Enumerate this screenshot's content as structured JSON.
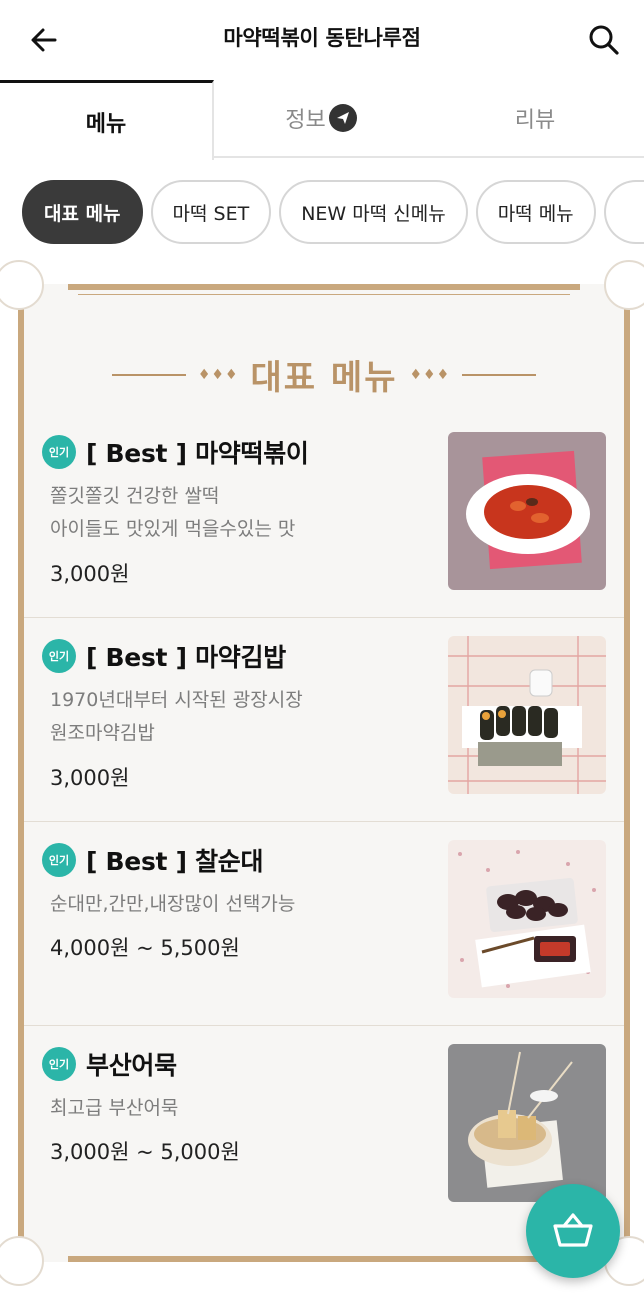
{
  "header": {
    "title": "마약떡볶이 동탄나루점",
    "back_icon": "arrow-left-icon",
    "search_icon": "search-icon"
  },
  "tabs": [
    {
      "label": "메뉴",
      "active": true
    },
    {
      "label": "정보",
      "active": false,
      "icon": "send-badge-icon"
    },
    {
      "label": "리뷰",
      "active": false
    }
  ],
  "chips": [
    {
      "label": "대표 메뉴",
      "active": true
    },
    {
      "label": "마떡 SET",
      "active": false
    },
    {
      "label": "NEW 마떡 신메뉴",
      "active": false
    },
    {
      "label": "마떡 메뉴",
      "active": false
    }
  ],
  "board": {
    "title": "대표 메뉴",
    "ornament": "♦♦♦"
  },
  "items": [
    {
      "badge": "인기",
      "name": "[ Best ] 마약떡볶이",
      "desc": [
        "쫄깃쫄깃 건강한 쌀떡",
        "아이들도 맛있게 먹을수있는 맛"
      ],
      "price": "3,000원"
    },
    {
      "badge": "인기",
      "name": "[ Best ] 마약김밥",
      "desc": [
        "1970년대부터 시작된 광장시장",
        "원조마약김밥"
      ],
      "price": "3,000원"
    },
    {
      "badge": "인기",
      "name": "[ Best ] 찰순대",
      "desc": [
        "순대만,간만,내장많이 선택가능"
      ],
      "price": "4,000원 ~ 5,500원"
    },
    {
      "badge": "인기",
      "name": "부산어묵",
      "desc": [
        "최고급 부산어묵"
      ],
      "price": "3,000원 ~ 5,000원"
    }
  ],
  "cart": {
    "icon": "basket-icon"
  },
  "colors": {
    "accent": "#2bb5a8",
    "frame": "#c9a87e",
    "title_gold": "#b99367",
    "chip_active": "#3a3a3a"
  }
}
